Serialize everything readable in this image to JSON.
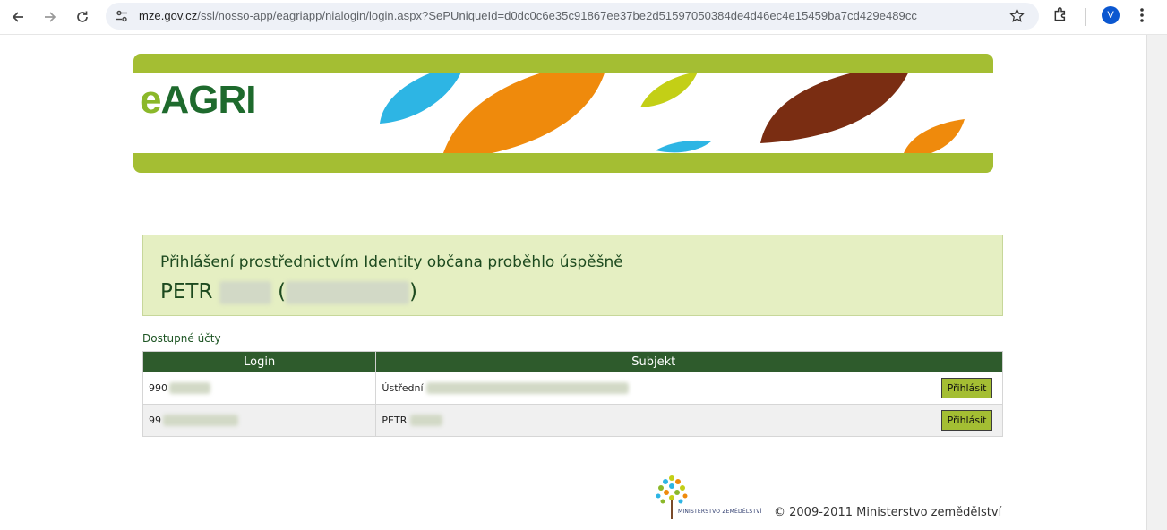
{
  "browser": {
    "url_host": "mze.gov.cz",
    "url_path": "/ssl/nosso-app/eagriapp/nialogin/login.aspx?SePUniqueId=d0dc0c6e35c91867ee37be2d51597050384de4d46ec4e15459ba7cd429e489cc",
    "avatar_letter": "V"
  },
  "banner": {
    "logo_e": "e",
    "logo_agri": "AGRI",
    "colors": {
      "green_bar": "#a4be33",
      "blue": "#2db5e4",
      "orange": "#ef8a0c",
      "yellow_green": "#c3cf16",
      "brown": "#7a2d12"
    }
  },
  "success": {
    "message": "Přihlášení prostřednictvím Identity občana proběhlo úspěšně",
    "name_first": "PETR",
    "paren_open": "(",
    "paren_close": ")"
  },
  "accounts": {
    "title": "Dostupné účty",
    "columns": [
      "Login",
      "Subjekt",
      ""
    ],
    "rows": [
      {
        "login": "990",
        "subject": "Ústřední",
        "button": "Přihlásit"
      },
      {
        "login": "99",
        "subject": "PETR",
        "button": "Přihlásit"
      }
    ]
  },
  "footer": {
    "ministry_logo_text": "MINISTERSTVO ZEMĚDĚLSTVÍ",
    "copyright": "© 2009-2011 Ministerstvo zemědělství"
  }
}
